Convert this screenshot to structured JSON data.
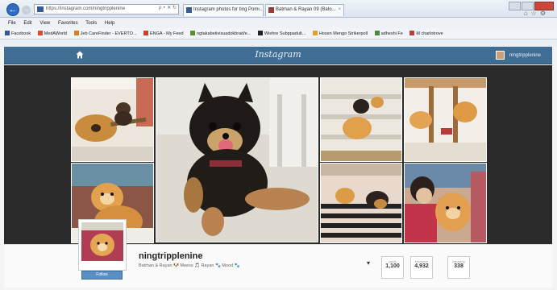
{
  "browser": {
    "address": "https://instagram.com/ningtripplenine",
    "address_controls": "ρ ‣ ✕ ↻",
    "tabs": [
      {
        "label": "Instagram photos for ting Pom..."
      },
      {
        "label": "Batman & Rayan 09 (Bato..."
      }
    ],
    "menu": [
      "File",
      "Edit",
      "View",
      "Favorites",
      "Tools",
      "Help"
    ],
    "bookmarks": [
      {
        "label": "Facebook",
        "color": "#3b5998"
      },
      {
        "label": "MedAWorld",
        "color": "#e24a2b"
      },
      {
        "label": "Jeb CareFinder - EVERTO...",
        "color": "#e27b20"
      },
      {
        "label": "ENGA - My Feed",
        "color": "#d93a2c"
      },
      {
        "label": "ngtakabetivisuadokbrad/e...",
        "color": "#5c8f2d"
      },
      {
        "label": "Wiehre Subppadult...",
        "color": "#222222"
      },
      {
        "label": "Hosen Mengo Strikerpoll",
        "color": "#e2a030"
      },
      {
        "label": "adheshi Fe",
        "color": "#4a8c3b"
      },
      {
        "label": "M charlotrove",
        "color": "#c43b3b"
      }
    ]
  },
  "instagram": {
    "logo": "Instagram",
    "header_user": "ningtripplenine",
    "username": "ningtripplenine",
    "bio": "Batman & Rayan 🐶 Meess 🎵 Rayan 🐾 Mood 🐾",
    "follow_label": "Follow",
    "stats": [
      {
        "label": "posts",
        "value": "1,100"
      },
      {
        "label": "followers",
        "value": "4,932"
      },
      {
        "label": "following",
        "value": "338"
      }
    ]
  },
  "colors": {
    "ig_header": "#3f6d94",
    "banner_bg": "#2a2a2a",
    "follow_button": "#5a8fc4"
  }
}
